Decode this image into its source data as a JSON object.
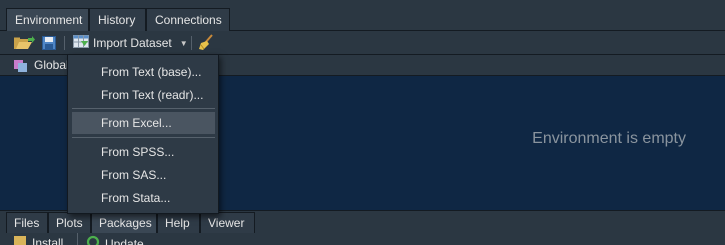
{
  "top_tabs": [
    {
      "label": "Environment",
      "active": true
    },
    {
      "label": "History",
      "active": false
    },
    {
      "label": "Connections",
      "active": false
    }
  ],
  "toolbar": {
    "open_icon": "folder-open-icon",
    "save_icon": "save-icon",
    "import_icon": "table-grid-icon",
    "import_label": "Import Dataset",
    "broom_icon": "broom-icon"
  },
  "env_selector": {
    "label": "Global",
    "icon": "r-environment-icon"
  },
  "main": {
    "empty_text": "Environment is empty"
  },
  "import_menu": {
    "items": [
      {
        "label": "From Text (base)...",
        "highlighted": false
      },
      {
        "label": "From Text (readr)...",
        "highlighted": false
      },
      {
        "label": "From Excel...",
        "highlighted": true
      },
      {
        "label": "From SPSS...",
        "highlighted": false
      },
      {
        "label": "From SAS...",
        "highlighted": false
      },
      {
        "label": "From Stata...",
        "highlighted": false
      }
    ]
  },
  "bottom_tabs": [
    {
      "label": "Files",
      "active": false
    },
    {
      "label": "Plots",
      "active": false
    },
    {
      "label": "Packages",
      "active": true
    },
    {
      "label": "Help",
      "active": false
    },
    {
      "label": "Viewer",
      "active": false
    }
  ],
  "bottom_toolbar": {
    "install_label": "Install",
    "update_label": "Update"
  }
}
